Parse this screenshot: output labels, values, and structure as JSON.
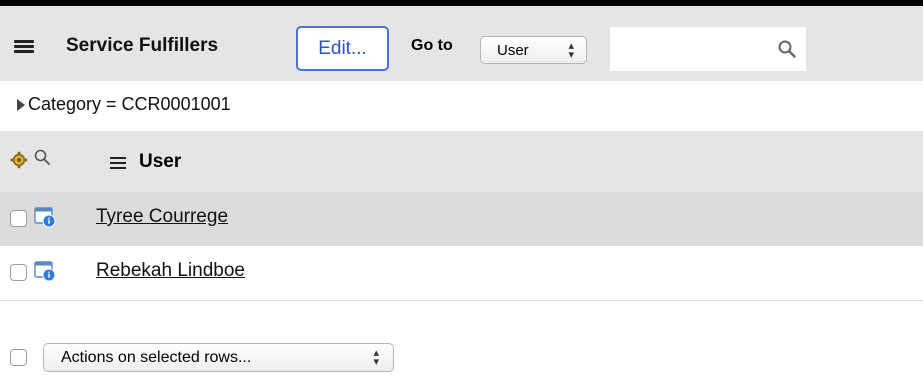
{
  "header": {
    "title": "Service Fulfillers",
    "edit_label": "Edit...",
    "goto_label": "Go to",
    "goto_selected": "User",
    "search_value": ""
  },
  "filter": {
    "text": "Category = CCR0001001"
  },
  "table": {
    "column_header": "User",
    "rows": [
      {
        "name": "Tyree Courrege"
      },
      {
        "name": "Rebekah Lindboe"
      }
    ]
  },
  "footer": {
    "actions_label": "Actions on selected rows..."
  },
  "colors": {
    "header_bg": "#e5e5e5",
    "edit_border": "#4a72d4",
    "selected_row_bg": "#dcdcdc",
    "record_icon": "#2b7de0"
  },
  "icons": {
    "menu": "hamburger-icon",
    "search": "magnifier-icon",
    "gear": "gear-icon",
    "record": "record-preview-icon",
    "filter_toggle": "disclosure-triangle-icon"
  }
}
